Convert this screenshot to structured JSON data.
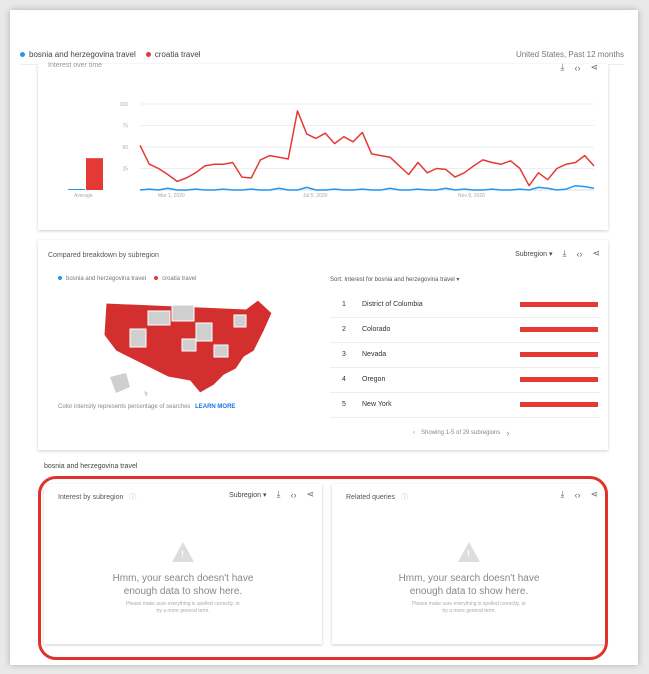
{
  "legend": {
    "series_a": "bosnia and herzegovina travel",
    "series_b": "croatia travel",
    "color_a": "#2196f3",
    "color_b": "#e53935",
    "region_time": "United States, Past 12 months"
  },
  "interest_over_time": {
    "title": "Interest over time",
    "y_ticks": [
      "100",
      "75",
      "50",
      "25"
    ],
    "x_ticks": [
      "Mar 1, 2020",
      "Jul 5, 2020",
      "Nov 8, 2020"
    ],
    "average_label": "Average",
    "average_values": {
      "bosnia": 1,
      "croatia": 37
    }
  },
  "chart_data": {
    "type": "line",
    "title": "Interest over time",
    "y_ticks": [
      100,
      75,
      50,
      25
    ],
    "ylim": [
      0,
      100
    ],
    "x_tick_labels": [
      "Mar 1, 2020",
      "Jul 5, 2020",
      "Nov 8, 2020"
    ],
    "series": [
      {
        "name": "croatia travel",
        "color": "#e53935",
        "values": [
          52,
          30,
          25,
          18,
          10,
          14,
          20,
          28,
          30,
          30,
          32,
          15,
          14,
          35,
          40,
          38,
          36,
          92,
          65,
          60,
          66,
          54,
          62,
          56,
          67,
          42,
          40,
          38,
          28,
          18,
          32,
          20,
          25,
          24,
          15,
          20,
          28,
          35,
          32,
          30,
          34,
          25,
          5,
          20,
          12,
          25,
          30,
          32,
          40,
          28
        ]
      },
      {
        "name": "bosnia and herzegovina travel",
        "color": "#2196f3",
        "values": [
          0,
          1,
          0,
          2,
          0,
          0,
          1,
          0,
          0,
          1,
          0,
          0,
          1,
          0,
          0,
          2,
          0,
          0,
          3,
          0,
          0,
          1,
          0,
          0,
          1,
          0,
          0,
          2,
          0,
          0,
          1,
          0,
          0,
          2,
          0,
          1,
          0,
          0,
          1,
          0,
          0,
          1,
          0,
          3,
          2,
          0,
          1,
          5,
          4,
          2
        ]
      }
    ]
  },
  "breakdown": {
    "title": "Compared breakdown by subregion",
    "subregion_label": "Subregion",
    "legend_a": "bosnia and herzegovina travel",
    "legend_b": "croatia travel",
    "sort_label": "Sort:",
    "sort_value": "Interest for bosnia and herzegovina travel",
    "note": "Color intensity represents percentage of searches",
    "learn_more": "LEARN MORE",
    "rows": [
      {
        "rank": "1",
        "name": "District of Columbia"
      },
      {
        "rank": "2",
        "name": "Colorado"
      },
      {
        "rank": "3",
        "name": "Nevada"
      },
      {
        "rank": "4",
        "name": "Oregon"
      },
      {
        "rank": "5",
        "name": "New York"
      }
    ],
    "pager": "Showing 1-5 of 29 subregions"
  },
  "section_label": "bosnia and herzegovina travel",
  "interest_by_subregion": {
    "title": "Interest by subregion",
    "subregion_label": "Subregion",
    "empty_title_1": "Hmm, your search doesn't have",
    "empty_title_2": "enough data to show here.",
    "empty_sub_1": "Please make sure everything is spelled correctly, or",
    "empty_sub_2": "try a more general term."
  },
  "related_queries": {
    "title": "Related queries",
    "empty_title_1": "Hmm, your search doesn't have",
    "empty_title_2": "enough data to show here.",
    "empty_sub_1": "Please make sure everything is spelled correctly, or",
    "empty_sub_2": "try a more general term."
  }
}
